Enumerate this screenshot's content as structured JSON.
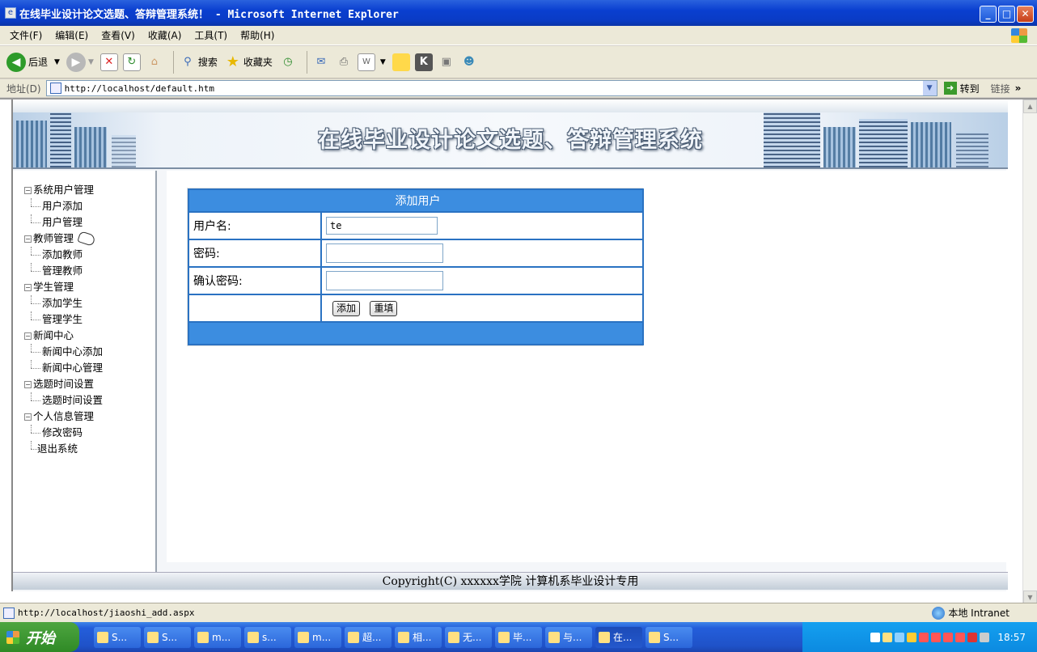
{
  "window": {
    "title": "在线毕业设计论文选题、答辩管理系统！ - Microsoft Internet Explorer",
    "icon": "ie-page-icon"
  },
  "menu": [
    "文件(F)",
    "编辑(E)",
    "查看(V)",
    "收藏(A)",
    "工具(T)",
    "帮助(H)"
  ],
  "toolbar": {
    "back": "后退",
    "search": "搜索",
    "favorites": "收藏夹"
  },
  "address": {
    "label": "地址(D)",
    "url": "http://localhost/default.htm",
    "go": "转到",
    "links": "链接"
  },
  "banner": {
    "title": "在线毕业设计论文选题、答辩管理系统"
  },
  "nav": {
    "groups": [
      {
        "label": "系统用户管理",
        "children": [
          "用户添加",
          "用户管理"
        ]
      },
      {
        "label": "教师管理",
        "children": [
          "添加教师",
          "管理教师"
        ]
      },
      {
        "label": "学生管理",
        "children": [
          "添加学生",
          "管理学生"
        ]
      },
      {
        "label": "新闻中心",
        "children": [
          "新闻中心添加",
          "新闻中心管理"
        ]
      },
      {
        "label": "选题时间设置",
        "children": [
          "选题时间设置"
        ]
      },
      {
        "label": "个人信息管理",
        "children": [
          "修改密码"
        ]
      }
    ],
    "logout": "退出系统"
  },
  "form": {
    "title": "添加用户",
    "username_label": "用户名:",
    "username_value": "te",
    "password_label": "密码:",
    "password_value": "",
    "confirm_label": "确认密码:",
    "confirm_value": "",
    "submit": "添加",
    "reset": "重填"
  },
  "footer": {
    "copyright": "Copyright(C) xxxxxx学院 计算机系毕业设计专用"
  },
  "status": {
    "url": "http://localhost/jiaoshi_add.aspx",
    "zone": "本地 Intranet"
  },
  "taskbar": {
    "start": "开始",
    "tasks": [
      "S...",
      "S...",
      "m...",
      "s...",
      "m...",
      "超...",
      "相...",
      "无...",
      "毕...",
      "与...",
      "在...",
      "S..."
    ],
    "active_index": 10,
    "clock": "18:57"
  }
}
